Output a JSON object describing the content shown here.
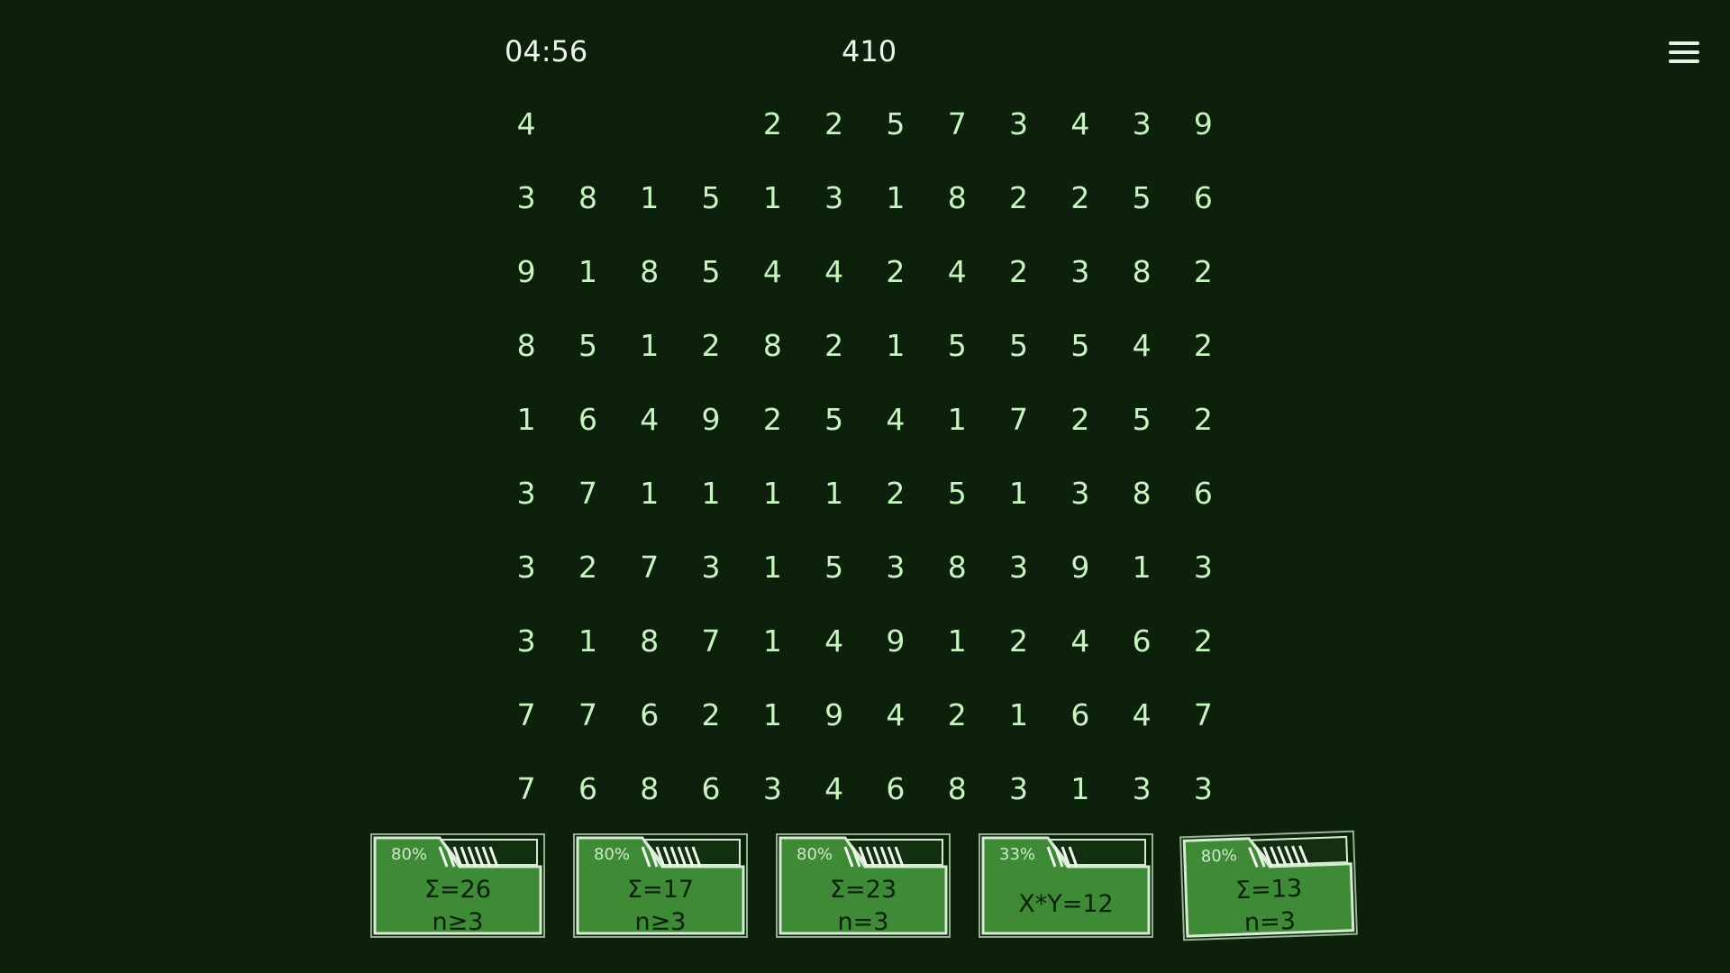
{
  "hud": {
    "timer": "04:56",
    "score": "410",
    "menu_icon": "hamburger-menu-icon"
  },
  "grid": [
    [
      "4",
      "",
      "",
      "",
      "2",
      "2",
      "5",
      "7",
      "3",
      "4",
      "3",
      "9"
    ],
    [
      "3",
      "8",
      "1",
      "5",
      "1",
      "3",
      "1",
      "8",
      "2",
      "2",
      "5",
      "6"
    ],
    [
      "9",
      "1",
      "8",
      "5",
      "4",
      "4",
      "2",
      "4",
      "2",
      "3",
      "8",
      "2"
    ],
    [
      "8",
      "5",
      "1",
      "2",
      "8",
      "2",
      "1",
      "5",
      "5",
      "5",
      "4",
      "2"
    ],
    [
      "1",
      "6",
      "4",
      "9",
      "2",
      "5",
      "4",
      "1",
      "7",
      "2",
      "5",
      "2"
    ],
    [
      "3",
      "7",
      "1",
      "1",
      "1",
      "1",
      "2",
      "5",
      "1",
      "3",
      "8",
      "6"
    ],
    [
      "3",
      "2",
      "7",
      "3",
      "1",
      "5",
      "3",
      "8",
      "3",
      "9",
      "1",
      "3"
    ],
    [
      "3",
      "1",
      "8",
      "7",
      "1",
      "4",
      "9",
      "1",
      "2",
      "4",
      "6",
      "2"
    ],
    [
      "7",
      "7",
      "6",
      "2",
      "1",
      "9",
      "4",
      "2",
      "1",
      "6",
      "4",
      "7"
    ],
    [
      "7",
      "6",
      "8",
      "6",
      "3",
      "4",
      "6",
      "8",
      "3",
      "1",
      "3",
      "3"
    ]
  ],
  "bins": [
    {
      "percent": "80%",
      "fill": 0.8,
      "line1": "Σ=26",
      "line2": "n≥3"
    },
    {
      "percent": "80%",
      "fill": 0.8,
      "line1": "Σ=17",
      "line2": "n≥3"
    },
    {
      "percent": "80%",
      "fill": 0.8,
      "line1": "Σ=23",
      "line2": "n=3"
    },
    {
      "percent": "33%",
      "fill": 0.33,
      "line1": "X*Y=12",
      "line2": ""
    },
    {
      "percent": "80%",
      "fill": 0.8,
      "line1": "Σ=13",
      "line2": "n=3",
      "open": true
    }
  ],
  "colors": {
    "background": "#0c200b",
    "digit": "#c8f4c2",
    "bin_fill": "#3e8a37",
    "bin_border": "#d6ecd2"
  }
}
